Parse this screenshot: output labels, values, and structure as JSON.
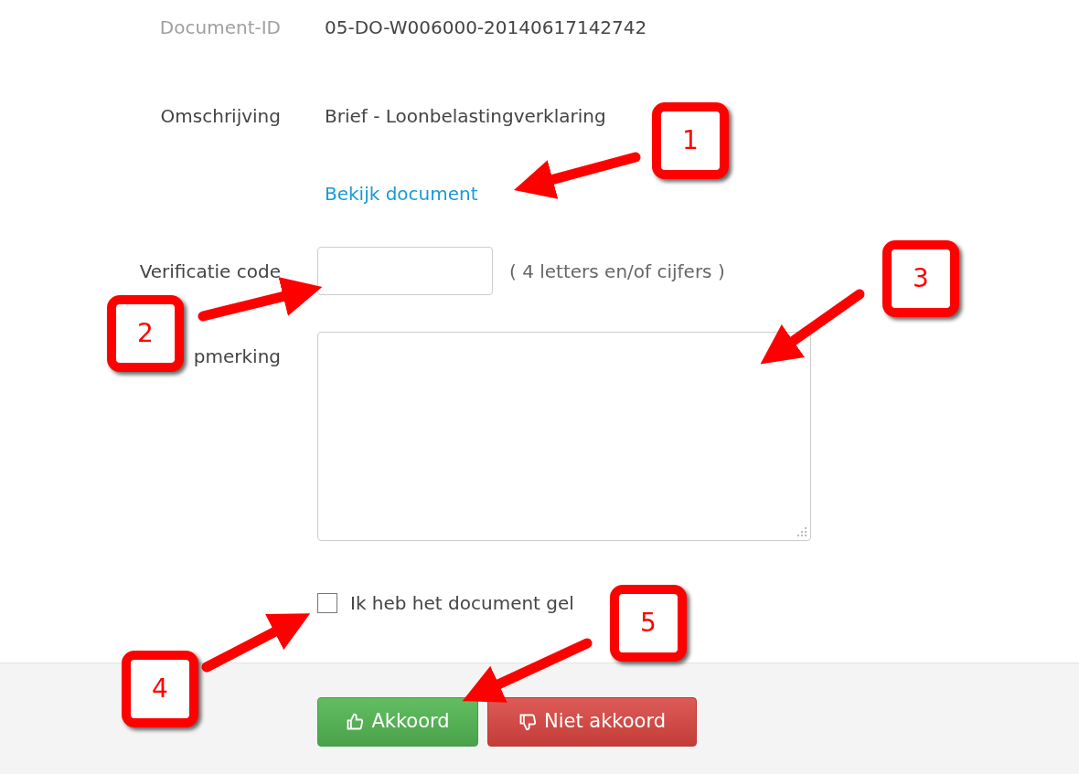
{
  "form": {
    "document_id": {
      "label": "Document-ID",
      "value": "05-DO-W006000-20140617142742"
    },
    "description": {
      "label": "Omschrijving",
      "value": "Brief - Loonbelastingverklaring"
    },
    "view_link": "Bekijk document",
    "verification": {
      "label": "Verificatie code",
      "hint": "( 4 letters en/of cijfers )"
    },
    "remark": {
      "label": "pmerking"
    },
    "confirm": {
      "label": "Ik heb het document gel",
      "checked": false
    }
  },
  "buttons": [
    {
      "kind": "accept",
      "label": "Akkoord"
    },
    {
      "kind": "reject",
      "label": "Niet akkoord"
    }
  ],
  "annotations": [
    {
      "label": "1"
    },
    {
      "label": "2"
    },
    {
      "label": "3"
    },
    {
      "label": "4"
    },
    {
      "label": "5"
    }
  ]
}
